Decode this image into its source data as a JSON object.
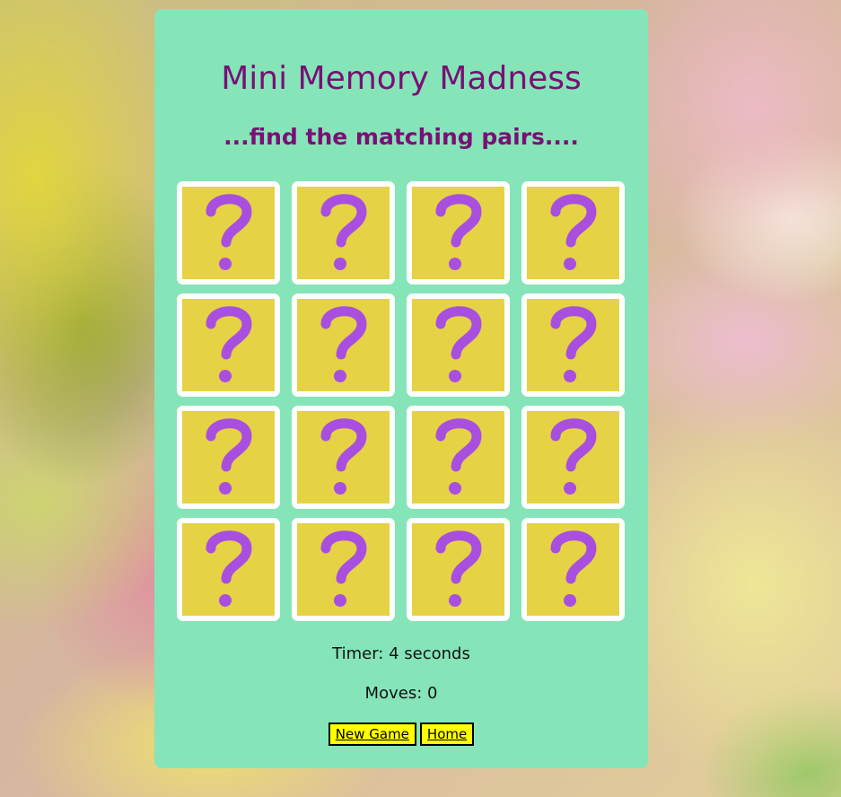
{
  "game": {
    "title": "Mini Memory Madness",
    "subtitle": "...find the matching pairs....",
    "card_back_symbol": "question-mark-icon",
    "cards": [
      {
        "state": "face-down"
      },
      {
        "state": "face-down"
      },
      {
        "state": "face-down"
      },
      {
        "state": "face-down"
      },
      {
        "state": "face-down"
      },
      {
        "state": "face-down"
      },
      {
        "state": "face-down"
      },
      {
        "state": "face-down"
      },
      {
        "state": "face-down"
      },
      {
        "state": "face-down"
      },
      {
        "state": "face-down"
      },
      {
        "state": "face-down"
      },
      {
        "state": "face-down"
      },
      {
        "state": "face-down"
      },
      {
        "state": "face-down"
      },
      {
        "state": "face-down"
      }
    ]
  },
  "stats": {
    "timer": "Timer: 4 seconds",
    "moves": "Moves: 0"
  },
  "buttons": {
    "new_game": "New Game",
    "home": "Home"
  },
  "colors": {
    "panel": "#85e5b8",
    "title": "#7a0f75",
    "card_face": "#e6d245",
    "card_border": "#ffffff",
    "question_mark": "#a84fe0",
    "button_bg": "#ffff00"
  }
}
